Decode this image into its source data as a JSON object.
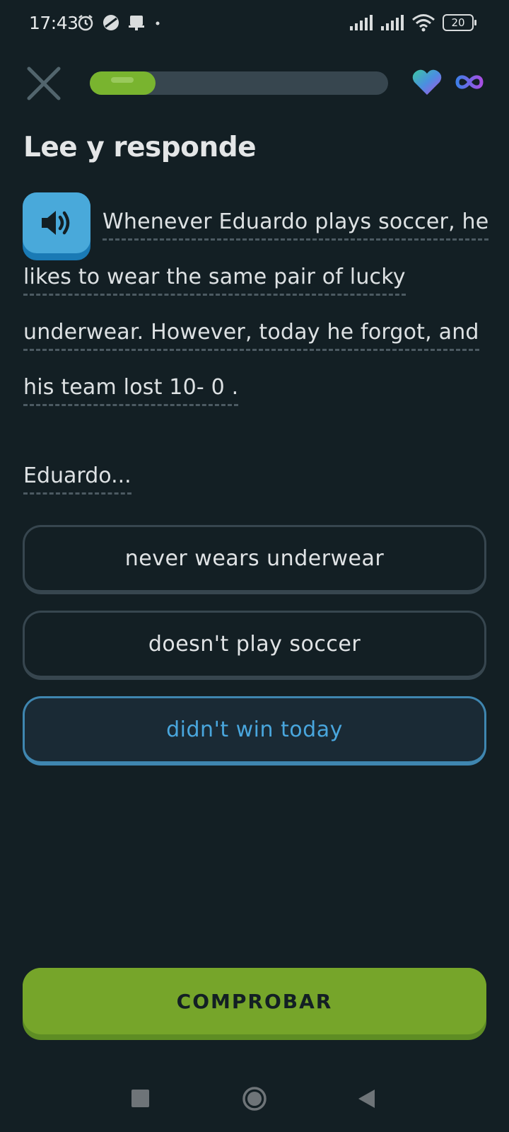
{
  "status_bar": {
    "time": "17:43",
    "battery": "20",
    "icons_left": [
      "alarm-icon",
      "do-not-disturb-icon",
      "notification-icon",
      "dot-icon"
    ],
    "icons_right": [
      "signal-icon",
      "signal-icon",
      "wifi-icon",
      "battery-icon"
    ]
  },
  "header": {
    "progress": 0.22,
    "progress_color": "#79b42f",
    "hearts": "infinite",
    "icons": [
      "close-icon",
      "heart-icon",
      "infinity-icon"
    ]
  },
  "lesson": {
    "title": "Lee y responde",
    "passage_lines": [
      "Whenever Eduardo plays soccer, he",
      "likes to wear the same pair of lucky",
      "underwear. However, today he forgot, and",
      "his team lost 10- 0 ."
    ],
    "prompt": "Eduardo...",
    "options": [
      {
        "label": "never wears underwear",
        "selected": false
      },
      {
        "label": "doesn't play soccer",
        "selected": false
      },
      {
        "label": "didn't win today",
        "selected": true
      }
    ],
    "check_label": "COMPROBAR"
  },
  "colors": {
    "background": "#131f24",
    "accent_green": "#76a52a",
    "accent_blue": "#49a9da"
  }
}
